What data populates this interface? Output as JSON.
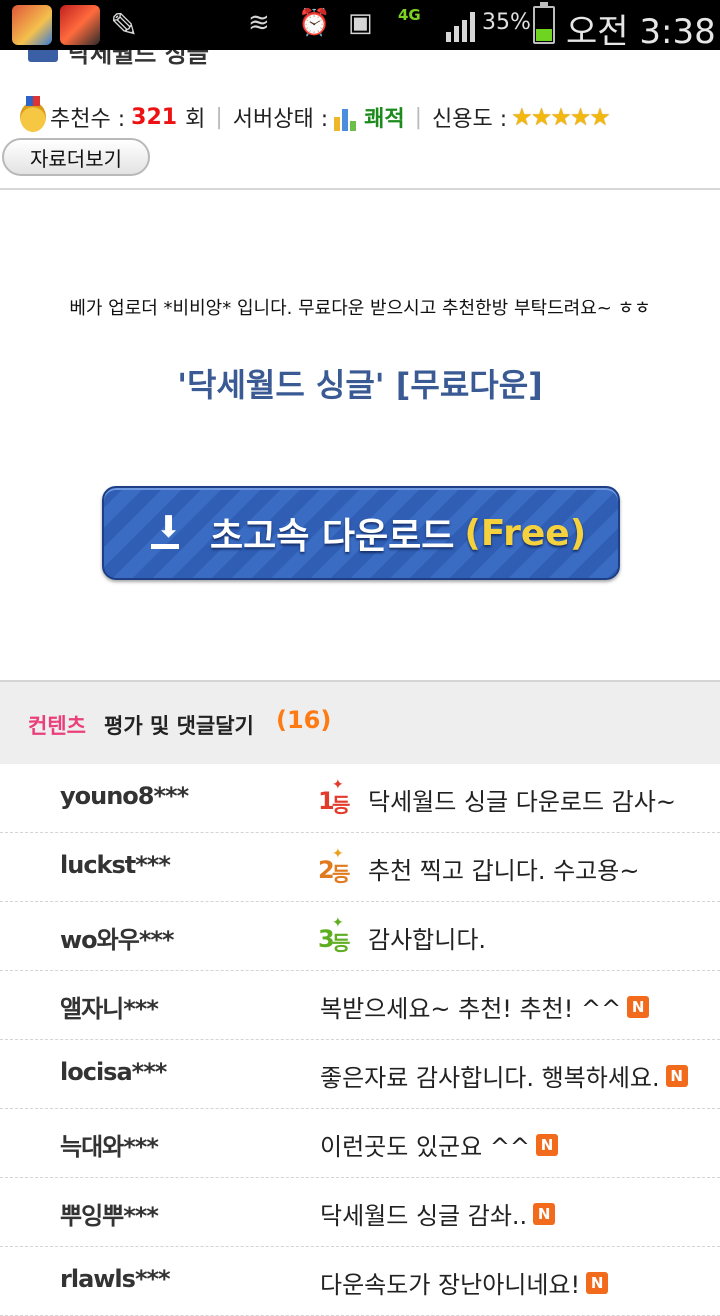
{
  "status_bar": {
    "apps": [
      "game-app-1",
      "game-app-2"
    ],
    "network": "4G",
    "battery_percent": "35%",
    "time": "오전 3:38"
  },
  "header": {
    "title": "닥세월드 싱글"
  },
  "info": {
    "recommend_label": "추천수 :",
    "recommend_count": "321",
    "recommend_unit": "회",
    "server_label": "서버상태 :",
    "server_value": "쾌적",
    "credit_label": "신용도 :",
    "credit_stars": "★★★★★",
    "more_button": "자료더보기"
  },
  "body": {
    "uploader_message": "베가 업로더 *비비앙* 입니다. 무료다운 받으시고 추천한방 부탁드려요~ ㅎㅎ",
    "download_title": "'닥세월드 싱글' [무료다운]",
    "download_button_text": "초고속 다운로드",
    "download_button_free": "(Free)"
  },
  "comments": {
    "header_pink": "컨텐츠",
    "header_rest": "평가 및 댓글달기",
    "count": "(16)",
    "rank_suffix": "등",
    "new_badge": "N",
    "items": [
      {
        "user": "youno8***",
        "rank": "1",
        "text": "닥세월드 싱글 다운로드 감사~"
      },
      {
        "user": "luckst***",
        "rank": "2",
        "text": "추천 찍고 갑니다. 수고용~"
      },
      {
        "user": "wo와우***",
        "rank": "3",
        "text": "감사합니다."
      },
      {
        "user": "앨자니***",
        "text": "복받으세요~ 추천! 추천! ^^"
      },
      {
        "user": "locisa***",
        "text": "좋은자료 감사합니다. 행복하세요."
      },
      {
        "user": "늑대와***",
        "text": "이런곳도 있군요 ^^"
      },
      {
        "user": "뿌잉뿌***",
        "text": "닥세월드 싱글 감솨.."
      },
      {
        "user": "rlawls***",
        "text": "다운속도가 장난아니네요!"
      }
    ]
  }
}
